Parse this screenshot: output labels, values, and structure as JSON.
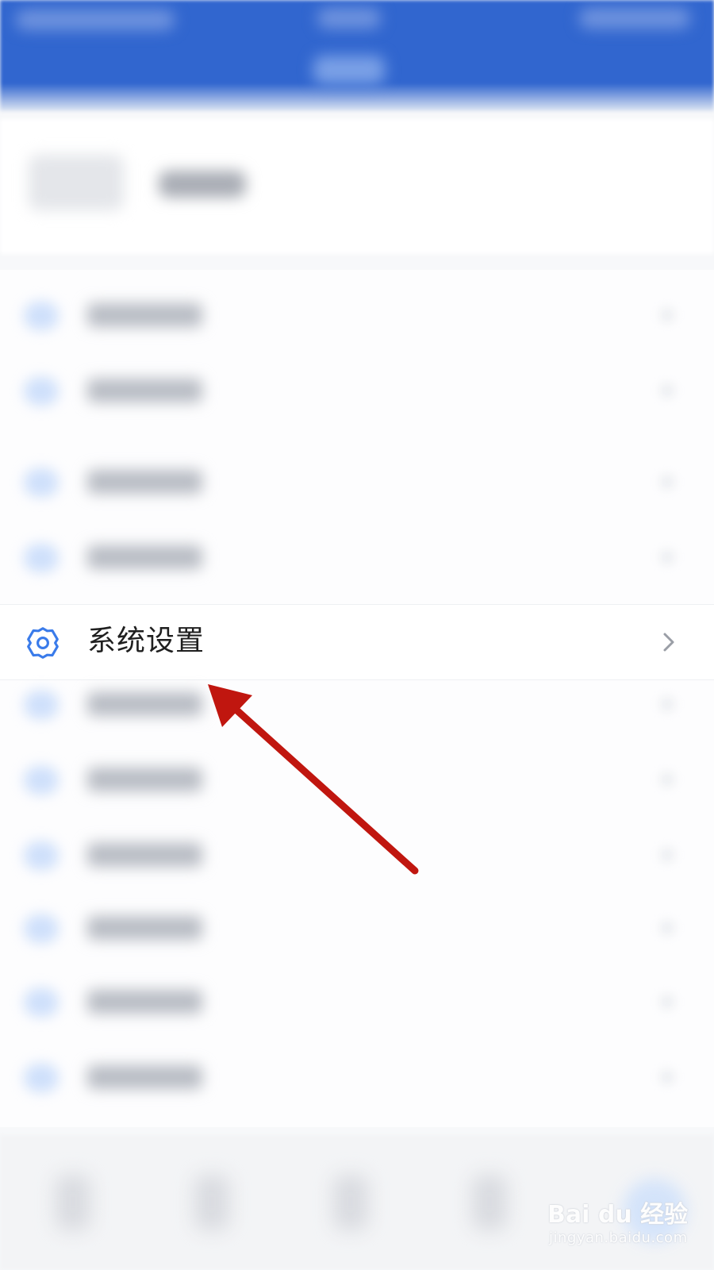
{
  "focused_item": {
    "label": "系统设置",
    "icon": "gear-icon",
    "chevron_icon": "chevron-right-icon"
  },
  "annotation": {
    "type": "arrow",
    "color": "#c0160f"
  },
  "watermark": {
    "main": "Bai du 经验",
    "sub": "jingyan.baidu.com"
  },
  "colors": {
    "header": "#3166cf",
    "accent_icon": "#3a7bea"
  }
}
